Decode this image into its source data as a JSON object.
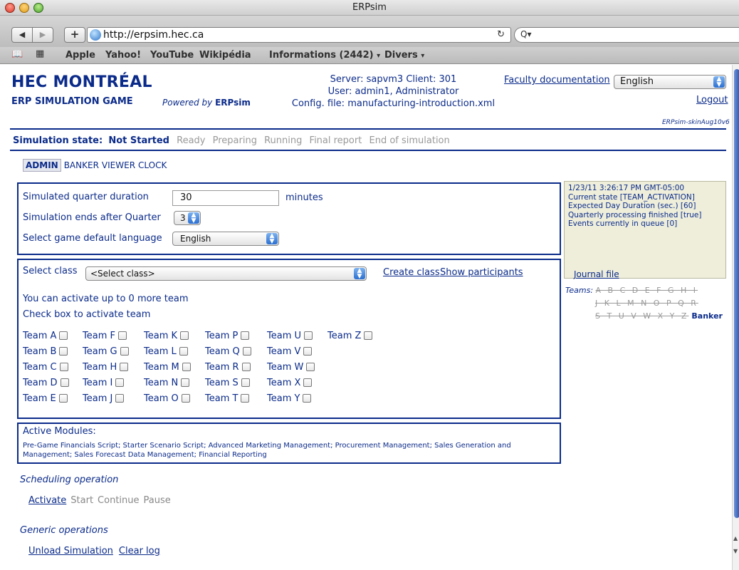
{
  "browser": {
    "window_title": "ERPsim",
    "url": "http://erpsim.hec.ca",
    "back_label": "◀",
    "forward_label": "▶",
    "add_label": "+",
    "reload_glyph": "↻",
    "search_glyph": "Q▾",
    "bookmarks_icon": "📖",
    "grid_icon": "▦",
    "bookmarks": [
      "Apple",
      "Yahoo!",
      "YouTube",
      "Wikipédia",
      "Informations (2442)",
      "Divers"
    ],
    "bookmark_caret": "▾"
  },
  "header": {
    "logo_main": "HEC MONTRÉAL",
    "logo_sub": "ERP SIMULATION GAME",
    "powered_by_prefix": "Powered by ",
    "powered_by_brand": "ERPsim",
    "server_line": "Server: sapvm3 Client: 301",
    "user_line": "User: admin1, Administrator",
    "config_line": "Config. file: manufacturing-introduction.xml",
    "faculty_doc": "Faculty documentation",
    "language": "English",
    "logout": "Logout",
    "skin_id": "ERPsim-skinAug10v6"
  },
  "state": {
    "label": "Simulation state:",
    "current": "Not Started",
    "steps": [
      "Ready",
      "Preparing",
      "Running",
      "Final report",
      "End of simulation"
    ]
  },
  "roles": [
    "ADMIN",
    "BANKER",
    "VIEWER",
    "CLOCK"
  ],
  "config": {
    "duration_label": "Simulated quarter duration",
    "duration_value": "30",
    "minutes_label": "minutes",
    "ends_label": "Simulation ends after Quarter",
    "ends_value": "3",
    "lang_label": "Select game default language",
    "lang_value": "English"
  },
  "teams_panel": {
    "select_class_label": "Select class",
    "select_class_value": "<Select class>",
    "create_class": "Create class",
    "show_participants": "Show participants",
    "activate_limit": "You can activate up to 0 more team",
    "check_hint": "Check box to activate team",
    "rows": [
      [
        "Team A",
        "Team F",
        "Team K",
        "Team P",
        "Team U",
        "Team Z"
      ],
      [
        "Team B",
        "Team G",
        "Team L",
        "Team Q",
        "Team V"
      ],
      [
        "Team C",
        "Team H",
        "Team M",
        "Team R",
        "Team W"
      ],
      [
        "Team D",
        "Team I",
        "Team N",
        "Team S",
        "Team X"
      ],
      [
        "Team E",
        "Team J",
        "Team O",
        "Team T",
        "Team Y"
      ]
    ]
  },
  "modules": {
    "title": "Active Modules:",
    "list": "Pre-Game Financials Script; Starter Scenario Script; Advanced Marketing Management; Procurement Management; Sales Generation and Management; Sales Forecast Data Management; Financial Reporting"
  },
  "scheduling": {
    "title": "Scheduling operation",
    "activate": "Activate",
    "start": "Start",
    "continue": "Continue",
    "pause": "Pause"
  },
  "generic": {
    "title": "Generic operations",
    "unload": "Unload Simulation",
    "clear_log": "Clear log"
  },
  "log": {
    "timestamp": "1/23/11 3:26:17 PM GMT-05:00",
    "state": "Current state [TEAM_ACTIVATION]",
    "day_duration": "Expected Day Duration (sec.) [60]",
    "quarterly": "Quarterly processing finished [true]",
    "events": "Events currently in queue [0]",
    "journal": "Journal file"
  },
  "teams_legend": {
    "label": "Teams:",
    "row1": "A B C D E F G H I",
    "row2": "J K L M N O P Q R",
    "row3": "S T U V W X Y Z",
    "banker": "Banker"
  },
  "colors": {
    "accent": "#0b2b8a",
    "log_bg": "#eeeedb",
    "disabled": "#999999"
  }
}
